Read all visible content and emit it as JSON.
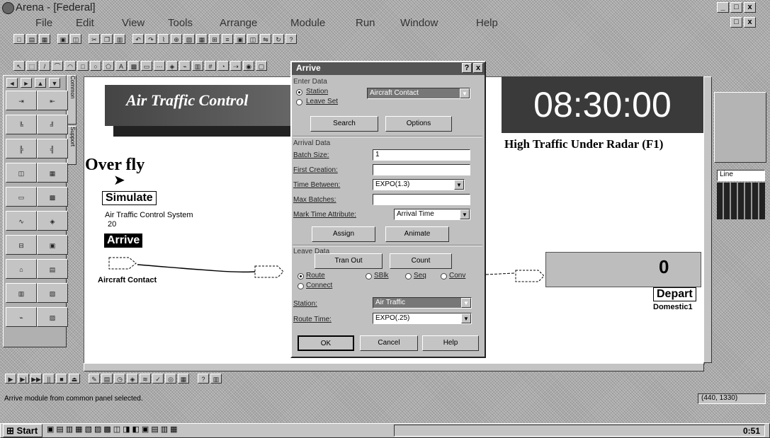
{
  "window": {
    "title": "Arena - [Federal]",
    "controls": [
      "_",
      "□",
      "x"
    ]
  },
  "menu": [
    "File",
    "Edit",
    "View",
    "Tools",
    "Arrange",
    "Module",
    "Run",
    "Window",
    "Help"
  ],
  "palette_tabs": [
    "Common",
    "Support"
  ],
  "line_select": "Line",
  "model": {
    "banner_title": "Air Traffic Control",
    "overfly_label": "Over fly",
    "simulate_label": "Simulate",
    "system_name": "Air Traffic Control System",
    "system_count": "20",
    "arrive_label": "Arrive",
    "aircraft_contact": "Aircraft Contact",
    "clock": "08:30:00",
    "traffic_label": "High Traffic Under Radar (F1)",
    "counter_value": "0",
    "depart_label": "Depart",
    "domestic_label": "Domestic1"
  },
  "dialog": {
    "title": "Arrive",
    "help": "?",
    "close": "x",
    "enter_section": "Enter Data",
    "enter_options": [
      "Station",
      "Leave Set"
    ],
    "station_value": "Aircraft Contact",
    "enter_buttons": [
      "Search",
      "Options"
    ],
    "arrival_section": "Arrival Data",
    "fields": [
      {
        "label": "Batch Size:",
        "value": "1"
      },
      {
        "label": "First Creation:",
        "value": ""
      },
      {
        "label": "Time Between:",
        "value": "EXPO(1.3)"
      },
      {
        "label": "Max Batches:",
        "value": ""
      },
      {
        "label": "Mark Time Attribute:",
        "value": "Arrival Time"
      }
    ],
    "arrival_buttons": [
      "Assign",
      "Animate"
    ],
    "leave_section": "Leave Data",
    "leave_buttons": [
      "Tran Out",
      "Count"
    ],
    "route_options": [
      "Route",
      "SBlk",
      "Seq",
      "Conv"
    ],
    "connect_option": "Connect",
    "station_label": "Station:",
    "station_field": "Air Traffic",
    "route_time_label": "Route Time:",
    "route_time_value": "EXPO(.25)",
    "footer_buttons": [
      "OK",
      "Cancel",
      "Help"
    ]
  },
  "status": {
    "message": "Arrive module from common panel selected.",
    "coords": "(440, 1330)"
  },
  "taskbar": {
    "start": "Start",
    "clock": "0:51"
  }
}
